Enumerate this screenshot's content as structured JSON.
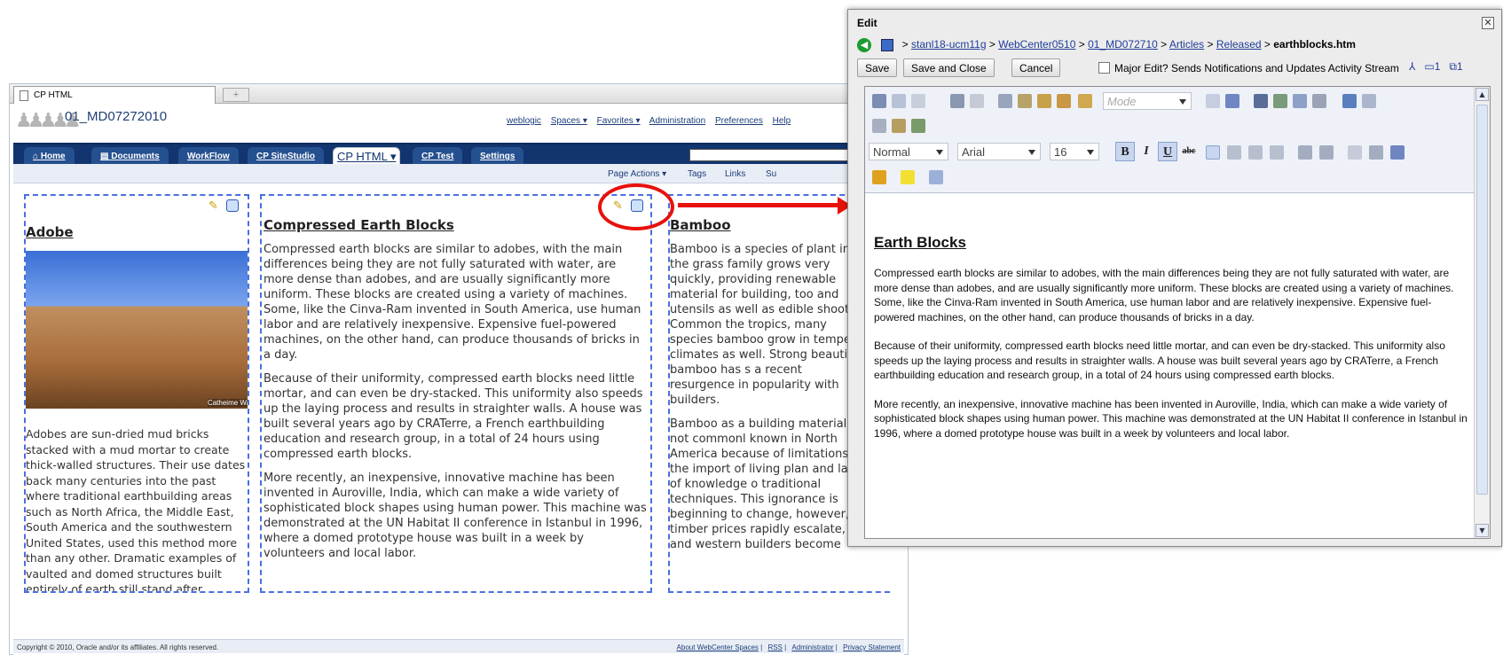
{
  "browser": {
    "tab_title": "CP HTML",
    "new_tab": "+"
  },
  "header": {
    "space_name": "01_MD07272010",
    "links": [
      "weblogic",
      "Spaces ▾",
      "Favorites ▾",
      "Administration",
      "Preferences",
      "Help"
    ]
  },
  "nav": {
    "tabs": [
      "Home",
      "Documents",
      "WorkFlow",
      "CP SiteStudio",
      "CP HTML ▾",
      "CP Test",
      "Settings"
    ]
  },
  "page_actions": {
    "actions": [
      "Page Actions ▾",
      "Tags",
      "Links",
      "Su"
    ]
  },
  "articles": {
    "adobe": {
      "title": "Adobe",
      "image_caption": "Catheime Wanek",
      "body": "Adobes are sun-dried mud bricks stacked with a mud mortar to create thick-walled structures. Their use dates back many centuries into the past where traditional earthbuilding areas such as North Africa, the Middle East, South America and the southwestern United States, used this method more than any other. Dramatic examples of vaulted and domed structures built entirely of earth still stand after centuries in the Middle East, testament to adobe's timeless beauty and"
    },
    "ceb": {
      "title": "Compressed Earth Blocks",
      "p1": "Compressed earth blocks are similar to adobes, with the main differences being they are not fully saturated with water, are more dense than adobes, and are usually significantly more uniform. These blocks are created using a variety of machines. Some, like the Cinva-Ram invented in South America, use human labor and are relatively inexpensive. Expensive fuel-powered machines, on the other hand, can produce thousands of bricks in a day.",
      "p2": "Because of their uniformity, compressed earth blocks need little mortar, and can even be dry-stacked. This uniformity also speeds up the laying process and results in straighter walls. A house was built several years ago by CRATerre, a French earthbuilding education and research group, in a total of 24 hours using compressed earth blocks.",
      "p3": "More recently, an inexpensive, innovative machine has been invented in Auroville, India, which can make a wide variety of sophisticated block shapes using human power. This machine was demonstrated at the UN Habitat II conference in Istanbul in 1996, where a domed prototype house was built in a week by volunteers and local labor."
    },
    "bamboo": {
      "title": "Bamboo",
      "p1": "Bamboo is a species of plant in the grass family grows very quickly, providing renewable material for building, too and utensils as well as edible shoots. Common the tropics, many species bamboo grow in tempera climates as well. Strong beautiful, bamboo has s a recent resurgence in popularity with builders.",
      "p2": "Bamboo as a building material is not commonl known in North America because of limitations o the import of living plan and lack of knowledge o traditional techniques. This ignorance is beginning to change, however, as timber prices rapidly escalate, and western builders become"
    }
  },
  "footer": {
    "copyright": "Copyright © 2010, Oracle and/or its affiliates. All rights reserved.",
    "links": [
      "About WebCenter Spaces",
      "RSS",
      "Administrator",
      "Privacy Statement"
    ]
  },
  "dialog": {
    "title": "Edit",
    "breadcrumb": [
      "stanl18-ucm11g",
      "WebCenter0510",
      "01_MD072710",
      "Articles",
      "Released"
    ],
    "breadcrumb_last": "earthblocks.htm",
    "buttons": {
      "save": "Save",
      "save_close": "Save and Close",
      "cancel": "Cancel"
    },
    "major_edit_label": "Major Edit? Sends Notifications and Updates Activity Stream",
    "right_counts": [
      "1",
      "1"
    ],
    "toolbar": {
      "mode": "Mode",
      "style": "Normal",
      "font": "Arial",
      "size": "16"
    },
    "content": {
      "heading": "Earth Blocks",
      "p1": "Compressed earth blocks are similar to adobes, with the main differences being they are not fully saturated with water, are more dense than adobes, and are usually significantly more uniform. These blocks are created using a variety of machines. Some, like the Cinva-Ram invented in South America, use human labor and are relatively inexpensive. Expensive fuel-powered machines, on the other hand, can produce thousands of bricks in a day.",
      "p2": "Because of their uniformity, compressed earth blocks need little mortar, and can even be dry-stacked. This uniformity also speeds up the laying process and results in straighter walls. A house was built several years ago by CRATerre, a French earthbuilding education and research group, in a total of 24 hours using compressed earth blocks.",
      "p3": "More recently, an inexpensive, innovative machine has been invented in Auroville, India, which can make a wide variety of sophisticated block shapes using human power. This machine was demonstrated at the UN Habitat II conference in Istanbul in 1996, where a domed prototype house was built in a week by volunteers and local labor."
    }
  },
  "colors": {
    "annotation": "#e8110c",
    "nav_bg": "#12356f",
    "dashed_border": "#4a6fe0"
  }
}
